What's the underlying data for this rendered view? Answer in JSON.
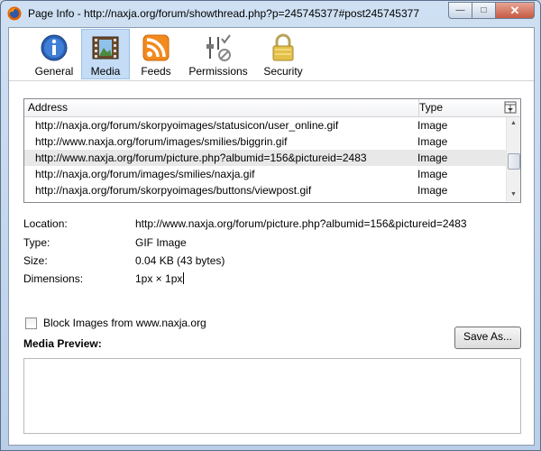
{
  "window": {
    "title": "Page Info - http://naxja.org/forum/showthread.php?p=245745377#post245745377",
    "controls": {
      "minimize": "—",
      "maximize": "□",
      "close": "✕"
    }
  },
  "tabs": [
    {
      "label": "General",
      "icon": "info-icon",
      "selected": false
    },
    {
      "label": "Media",
      "icon": "media-image-icon",
      "selected": true
    },
    {
      "label": "Feeds",
      "icon": "rss-feed-icon",
      "selected": false
    },
    {
      "label": "Permissions",
      "icon": "permissions-icon",
      "selected": false
    },
    {
      "label": "Security",
      "icon": "padlock-icon",
      "selected": false
    }
  ],
  "media_list": {
    "columns": {
      "address": "Address",
      "type": "Type"
    },
    "rows": [
      {
        "address": "http://naxja.org/forum/skorpyoimages/statusicon/user_online.gif",
        "type": "Image"
      },
      {
        "address": "http://www.naxja.org/forum/images/smilies/biggrin.gif",
        "type": "Image"
      },
      {
        "address": "http://www.naxja.org/forum/picture.php?albumid=156&pictureid=2483",
        "type": "Image",
        "selected": true
      },
      {
        "address": "http://naxja.org/forum/images/smilies/naxja.gif",
        "type": "Image"
      },
      {
        "address": "http://naxja.org/forum/skorpyoimages/buttons/viewpost.gif",
        "type": "Image"
      }
    ]
  },
  "details": {
    "location_label": "Location:",
    "location_value": "http://www.naxja.org/forum/picture.php?albumid=156&pictureid=2483",
    "type_label": "Type:",
    "type_value": "GIF Image",
    "size_label": "Size:",
    "size_value": "0.04 KB (43 bytes)",
    "dimensions_label": "Dimensions:",
    "dimensions_value": "1px × 1px"
  },
  "block_images": {
    "label": "Block Images from www.naxja.org",
    "checked": false
  },
  "preview": {
    "label": "Media Preview:",
    "save_as_label": "Save As..."
  },
  "colors": {
    "selected_tab_bg": "#c4dcf5",
    "window_frame": "#b9cfe8",
    "close_button": "#c65a43"
  }
}
